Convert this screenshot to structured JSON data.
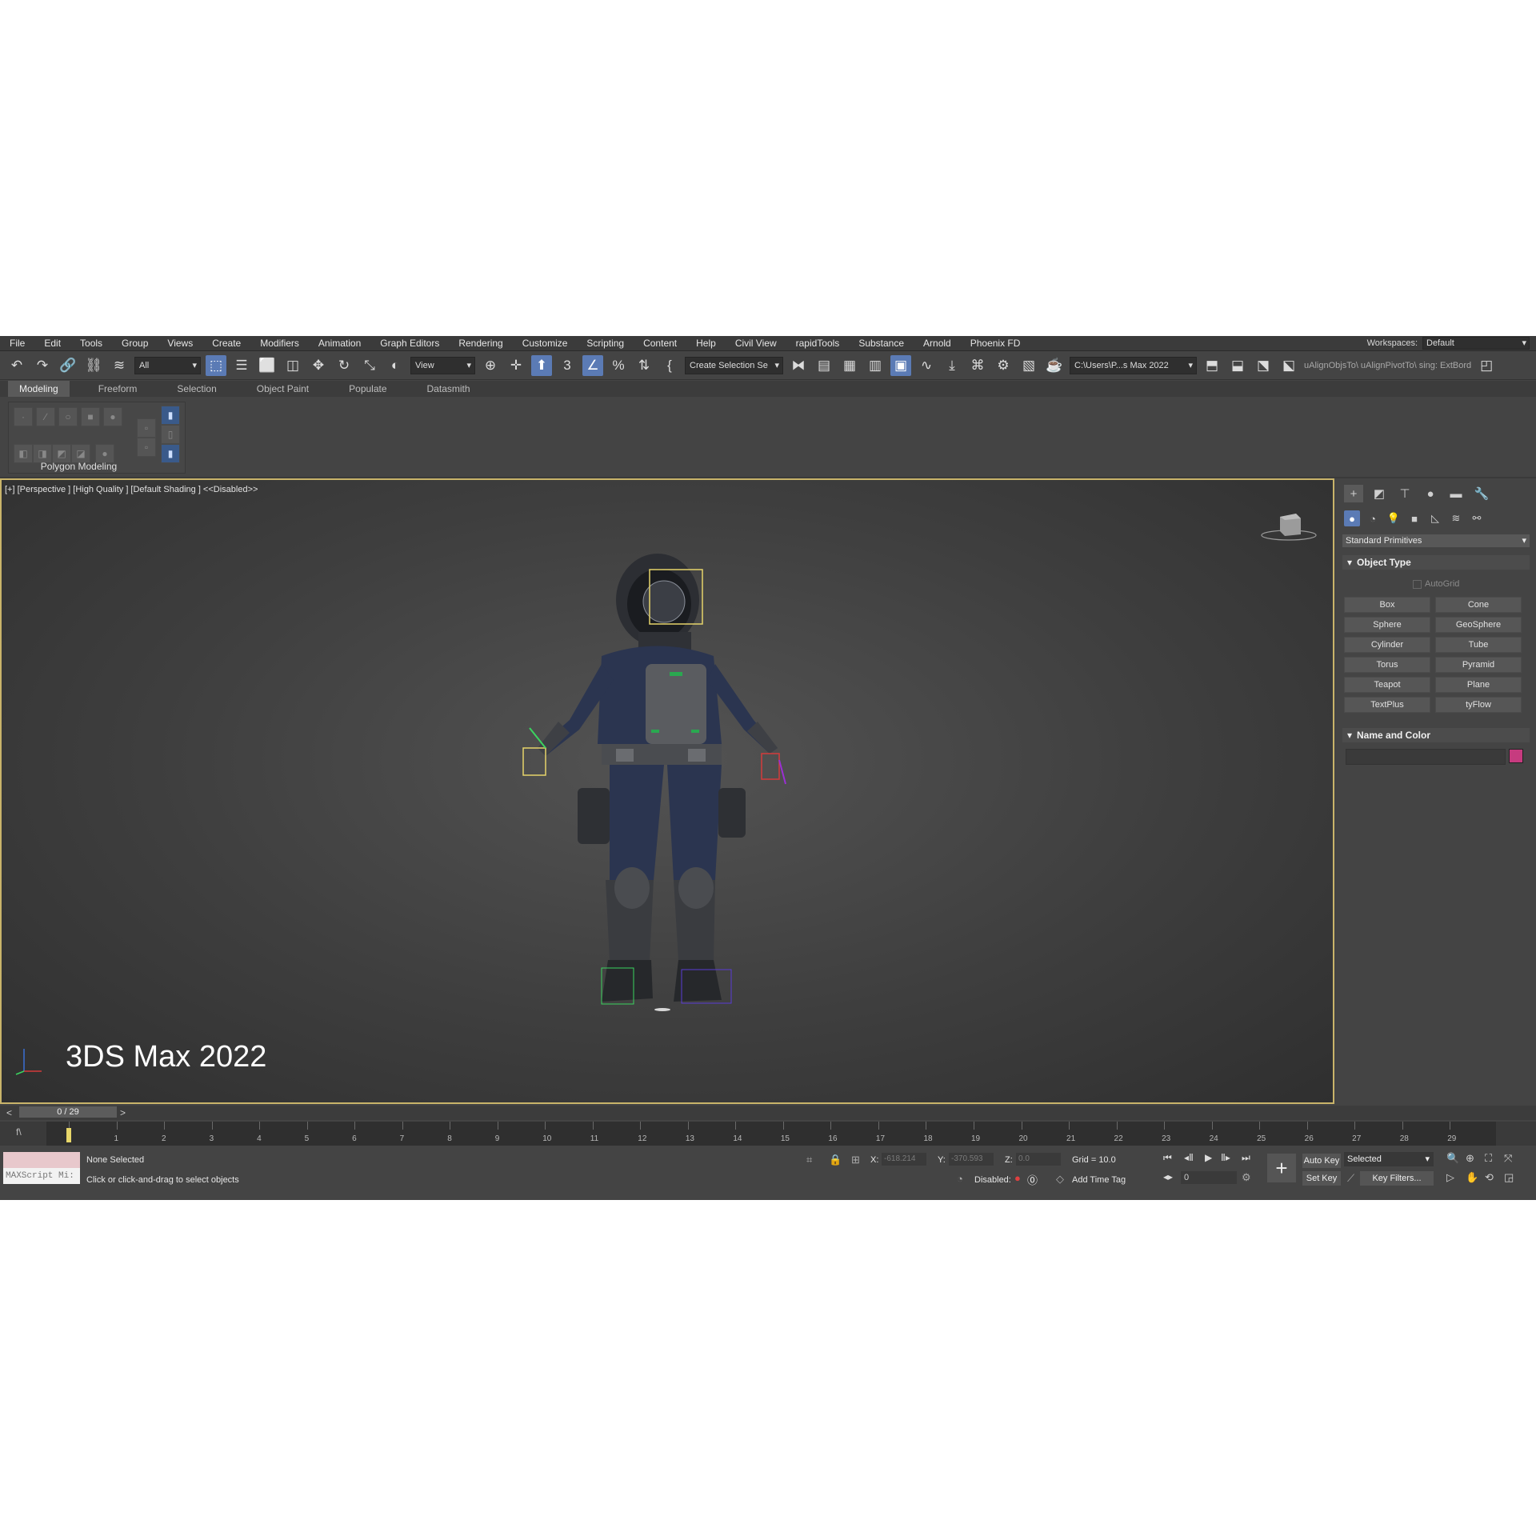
{
  "menu": [
    "File",
    "Edit",
    "Tools",
    "Group",
    "Views",
    "Create",
    "Modifiers",
    "Animation",
    "Graph Editors",
    "Rendering",
    "Customize",
    "Scripting",
    "Content",
    "Help",
    "Civil View",
    "rapidTools",
    "Substance",
    "Arnold",
    "Phoenix FD"
  ],
  "workspace": {
    "label": "Workspaces:",
    "value": "Default"
  },
  "toolbar": {
    "filter": "All",
    "coord_system": "View",
    "selection_set": "Create Selection Se",
    "project_path": "C:\\Users\\P...s Max 2022",
    "script_text": "uAlignObjsTo\\  uAlignPivotTo\\  sing: ExtBord"
  },
  "ribbon": {
    "tabs": [
      "Modeling",
      "Freeform",
      "Selection",
      "Object Paint",
      "Populate",
      "Datasmith"
    ],
    "group_label": "Polygon Modeling"
  },
  "viewport": {
    "label": "[+] [Perspective ] [High Quality ] [Default Shading ]  <<Disabled>>",
    "watermark": "3DS Max 2022"
  },
  "command_panel": {
    "category": "Standard Primitives",
    "object_type_title": "Object Type",
    "autogrid": "AutoGrid",
    "primitives": [
      "Box",
      "Cone",
      "Sphere",
      "GeoSphere",
      "Cylinder",
      "Tube",
      "Torus",
      "Pyramid",
      "Teapot",
      "Plane",
      "TextPlus",
      "tyFlow"
    ],
    "name_color_title": "Name and Color",
    "object_color": "#c63b7f"
  },
  "timeline": {
    "slider_text": "0 / 29",
    "left_arrow": "<",
    "right_arrow": ">",
    "ticks": [
      "0",
      "1",
      "2",
      "3",
      "4",
      "5",
      "6",
      "7",
      "8",
      "9",
      "10",
      "11",
      "12",
      "13",
      "14",
      "15",
      "16",
      "17",
      "18",
      "19",
      "20",
      "21",
      "22",
      "23",
      "24",
      "25",
      "26",
      "27",
      "28",
      "29"
    ]
  },
  "status": {
    "maxscript_placeholder": "MAXScript Mi:",
    "selection": "None Selected",
    "prompt": "Click or click-and-drag to select objects",
    "x_label": "X:",
    "x_value": "-618.214",
    "y_label": "Y:",
    "y_value": "-370.593",
    "z_label": "Z:",
    "z_value": "0.0",
    "grid": "Grid = 10.0",
    "disabled": "Disabled:",
    "add_time_tag": "Add Time Tag",
    "frame": "0",
    "auto_key": "Auto Key",
    "set_key": "Set Key",
    "key_mode": "Selected",
    "key_filters": "Key Filters..."
  }
}
